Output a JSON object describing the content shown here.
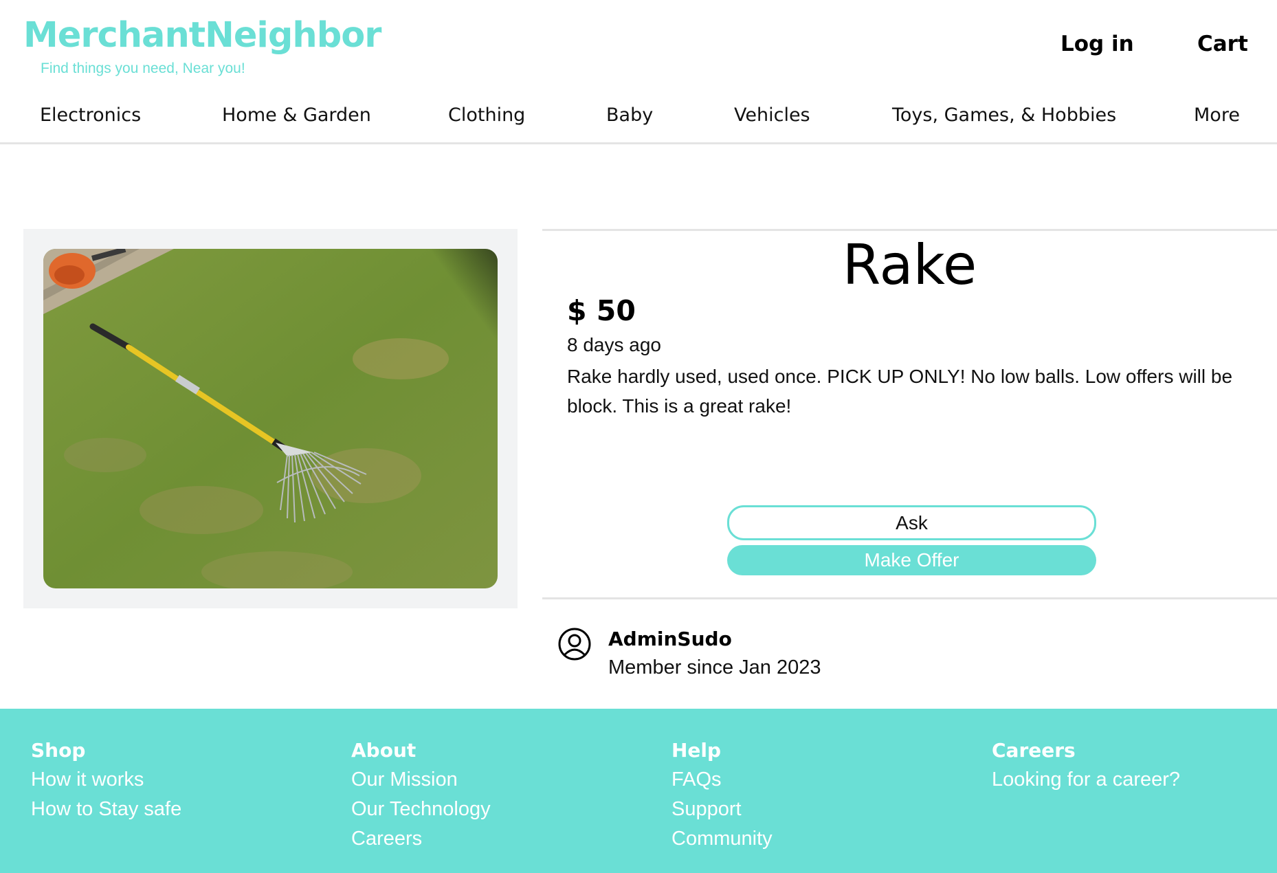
{
  "brand": {
    "name": "MerchantNeighbor",
    "tagline": "Find things you need, Near you!",
    "color": "#6adfd5"
  },
  "header": {
    "login": "Log in",
    "cart": "Cart"
  },
  "nav": [
    "Electronics",
    "Home & Garden",
    "Clothing",
    "Baby",
    "Vehicles",
    "Toys, Games, & Hobbies",
    "More"
  ],
  "listing": {
    "title": "Rake",
    "price": "$ 50",
    "posted": "8 days ago",
    "description": "Rake hardly used, used once. PICK UP ONLY! No low balls. Low offers will be block. This is a great rake!",
    "ask_label": "Ask",
    "offer_label": "Make Offer"
  },
  "seller": {
    "name": "AdminSudo",
    "member_since": "Member since Jan 2023",
    "icon": "user-circle-icon"
  },
  "footer": {
    "shop": {
      "heading": "Shop",
      "links": [
        "How it works",
        "How to Stay safe"
      ]
    },
    "about": {
      "heading": "About",
      "links": [
        "Our Mission",
        "Our Technology",
        "Careers"
      ]
    },
    "help": {
      "heading": "Help",
      "links": [
        "FAQs",
        "Support",
        "Community"
      ]
    },
    "careers": {
      "heading": "Careers",
      "links": [
        "Looking for a career?"
      ]
    }
  }
}
